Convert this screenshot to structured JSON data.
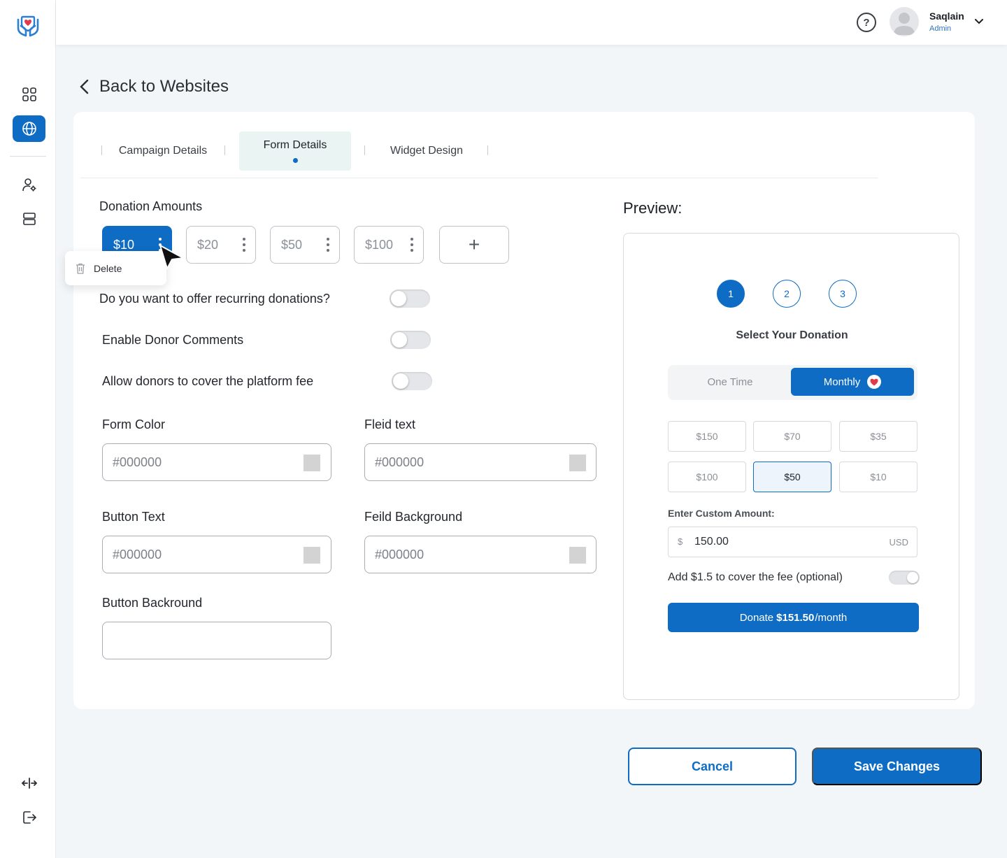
{
  "app": {
    "brand_color": "#0e6cc4"
  },
  "sidebar": {
    "items": [
      {
        "icon": "dashboard-grid-icon"
      },
      {
        "icon": "globe-icon",
        "active": true
      },
      {
        "icon": "user-settings-icon"
      },
      {
        "icon": "database-icon"
      },
      {
        "icon": "expand-horizontal-icon"
      },
      {
        "icon": "logout-icon"
      }
    ]
  },
  "header": {
    "help_symbol": "?",
    "user_name": "Saqlain",
    "user_role": "Admin"
  },
  "back_link": {
    "label": "Back to Websites"
  },
  "tabs": [
    {
      "label": "Campaign Details"
    },
    {
      "label": "Form Details",
      "active": true
    },
    {
      "label": "Widget Design"
    }
  ],
  "form": {
    "donation_amounts_label": "Donation Amounts",
    "amounts": [
      "$10",
      "$20",
      "$50",
      "$100"
    ],
    "add_symbol": "+",
    "selected_amount": "$10",
    "context_menu": {
      "delete_label": "Delete"
    },
    "toggles": [
      {
        "label": "Do you want to offer recurring donations?",
        "on": false
      },
      {
        "label": "Enable Donor Comments",
        "on": false
      },
      {
        "label": "Allow donors to cover the platform fee",
        "on": false
      }
    ],
    "colors": {
      "form_color": {
        "label": "Form Color",
        "placeholder": "#000000"
      },
      "field_text": {
        "label": "Fleid text",
        "placeholder": "#000000"
      },
      "button_text": {
        "label": "Button Text",
        "placeholder": "#000000"
      },
      "field_background": {
        "label": "Feild Background",
        "placeholder": "#000000"
      },
      "button_background": {
        "label": "Button Backround",
        "value": ""
      }
    }
  },
  "preview": {
    "title": "Preview:",
    "steps": [
      "1",
      "2",
      "3"
    ],
    "heading": "Select Your Donation",
    "frequency": {
      "one_time": "One Time",
      "monthly": "Monthly",
      "selected": "Monthly"
    },
    "amounts": [
      "$150",
      "$70",
      "$35",
      "$100",
      "$50",
      "$10"
    ],
    "selected_amount": "$50",
    "custom_amount_label": "Enter Custom Amount:",
    "custom_currency": "$",
    "custom_value": "150.00",
    "custom_unit": "USD",
    "fee_label": "Add $1.5 to cover the fee (optional)",
    "donate": {
      "prefix": "Donate",
      "amount": "$151.50",
      "suffix": "/month"
    }
  },
  "footer": {
    "cancel_label": "Cancel",
    "save_label": "Save Changes"
  }
}
